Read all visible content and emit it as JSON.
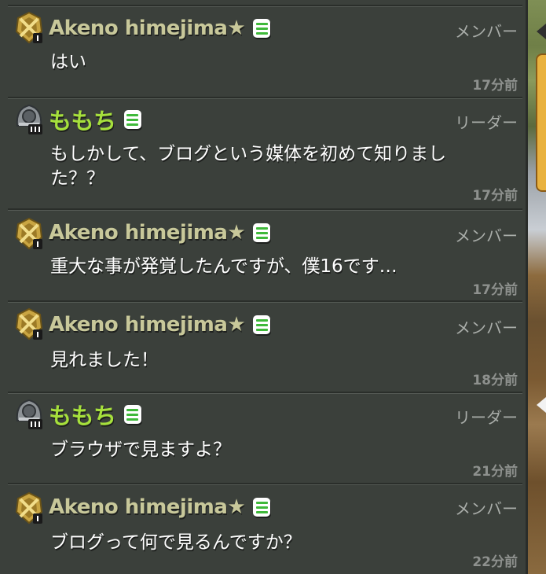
{
  "colors": {
    "panel_bg": "#3b403b",
    "member_name": "#c8c89a",
    "leader_name": "#a6e03c",
    "message_text": "#ffffff",
    "role_text": "#a9ada9",
    "time_text": "#8e918e",
    "online_icon": "#3fb93a"
  },
  "messages": [
    {
      "name": "Akeno himejima★",
      "role": "メンバー",
      "text": "はい",
      "time": "17分前",
      "badge_icon": "gold-league-badge-icon",
      "rank": "leader-false"
    },
    {
      "name": "ももち",
      "role": "リーダー",
      "text": "もしかして、ブログという媒体を初めて知りました？？",
      "time": "17分前",
      "badge_icon": "silver-league-badge-icon"
    },
    {
      "name": "Akeno himejima★",
      "role": "メンバー",
      "text": "重大な事が発覚したんですが、僕16です…",
      "time": "17分前",
      "badge_icon": "gold-league-badge-icon"
    },
    {
      "name": "Akeno himejima★",
      "role": "メンバー",
      "text": "見れました！",
      "time": "18分前",
      "badge_icon": "gold-league-badge-icon"
    },
    {
      "name": "ももち",
      "role": "リーダー",
      "text": "ブラウザで見ますよ？",
      "time": "21分前",
      "badge_icon": "silver-league-badge-icon"
    },
    {
      "name": "Akeno himejima★",
      "role": "メンバー",
      "text": "ブログって何で見るんですか？",
      "time": "22分前",
      "badge_icon": "gold-league-badge-icon"
    }
  ]
}
